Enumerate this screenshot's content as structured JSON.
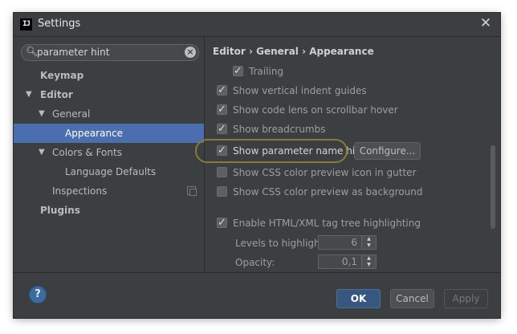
{
  "window": {
    "title": "Settings",
    "app_icon_text": "IJ",
    "close_glyph": "✕"
  },
  "sidebar": {
    "search": {
      "value": "parameter hint",
      "placeholder": ""
    },
    "items": [
      {
        "label": "Keymap"
      },
      {
        "label": "Editor"
      },
      {
        "label": "General"
      },
      {
        "label": "Appearance"
      },
      {
        "label": "Colors & Fonts"
      },
      {
        "label": "Language Defaults"
      },
      {
        "label": "Inspections"
      },
      {
        "label": "Plugins"
      }
    ]
  },
  "content": {
    "breadcrumb": "Editor › General › Appearance",
    "options": [
      {
        "label": "Trailing",
        "checked": true
      },
      {
        "label": "Show vertical indent guides",
        "checked": true
      },
      {
        "label": "Show code lens on scrollbar hover",
        "checked": true
      },
      {
        "label": "Show breadcrumbs",
        "checked": true
      },
      {
        "label": "Show parameter name hints",
        "checked": true
      },
      {
        "label": "Show CSS color preview icon in gutter",
        "checked": false
      },
      {
        "label": "Show CSS color preview as background",
        "checked": false
      },
      {
        "label": "Enable HTML/XML tag tree highlighting",
        "checked": true
      }
    ],
    "configure_label": "Configure...",
    "levels": {
      "label": "Levels to highlight:",
      "value": "6"
    },
    "opacity": {
      "label": "Opacity:",
      "value": "0,1"
    }
  },
  "footer": {
    "help_label": "?",
    "ok_label": "OK",
    "cancel_label": "Cancel",
    "apply_label": "Apply"
  },
  "colors": {
    "selection": "#4b6eaf",
    "highlight_ring": "#8a7a3a",
    "background": "#3c3f41"
  }
}
